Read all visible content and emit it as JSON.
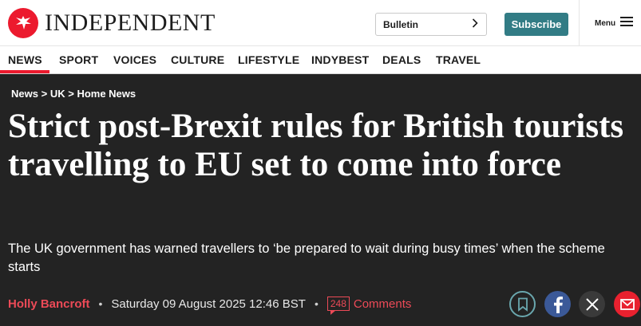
{
  "header": {
    "logo_text": "INDEPENDENT",
    "bulletin_label": "Bulletin",
    "subscribe_label": "Subscribe",
    "menu_label": "Menu"
  },
  "nav": {
    "items": [
      "NEWS",
      "SPORT",
      "VOICES",
      "CULTURE",
      "LIFESTYLE",
      "INDYBEST",
      "DEALS",
      "TRAVEL"
    ],
    "active": "NEWS"
  },
  "breadcrumb": {
    "items": [
      "News",
      "UK",
      "Home News"
    ],
    "separator": ">"
  },
  "article": {
    "headline": "Strict post-Brexit rules for British tourists travelling to EU set to come into force",
    "standfirst": "The UK government has warned travellers to ‘be prepared to wait during busy times’ when the scheme starts",
    "author": "Holly Bancroft",
    "date": "Saturday 09 August 2025 12:46 BST",
    "comment_count": "248",
    "comments_label": "Comments"
  },
  "share_icons": [
    "bookmark-icon",
    "facebook-icon",
    "x-icon",
    "email-icon"
  ],
  "colors": {
    "brand_red": "#ec1a2e",
    "subscribe_teal": "#327c85",
    "background": "#232323",
    "facebook_blue": "#3b5998"
  }
}
